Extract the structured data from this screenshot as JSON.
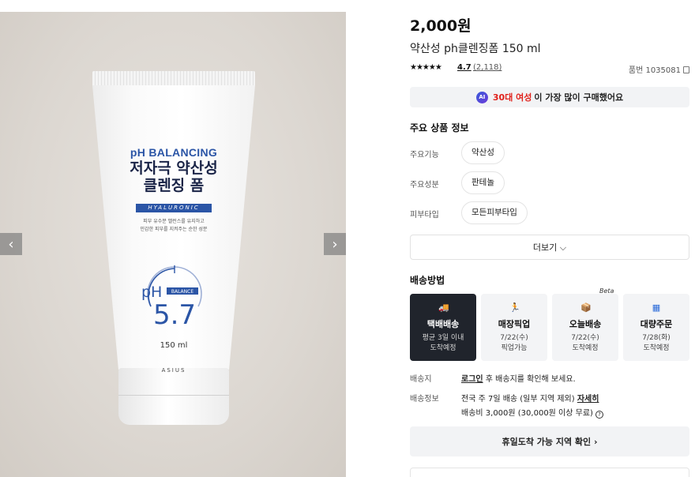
{
  "gallery": {
    "prev_icon": "chevron-left-icon",
    "next_icon": "chevron-right-icon",
    "product_image": {
      "brand_line": "pH BALANCING",
      "title_line1": "저자극 약산성",
      "title_line2": "클렌징 폼",
      "badge": "HYALURONIC",
      "desc_line1": "피부 유수분 밸런스를 유지하고",
      "desc_line2": "민감한 피부를 지켜주는 순한 성분",
      "ph_prefix": "pH",
      "ph_badge": "BALANCE",
      "ph_value": "5.7",
      "volume": "150 ml",
      "logo": "ASIUS"
    }
  },
  "product": {
    "price": "2,000원",
    "name": "약산성 ph클렌징폼 150 ml",
    "stars": "★★★★★",
    "rating": "4.7",
    "review_count": "(2,118)",
    "product_number": "품번 1035081"
  },
  "ai_banner": {
    "badge": "AI",
    "highlight": "30대 여성",
    "rest": "이 가장 많이 구매했어요"
  },
  "specs": {
    "title": "주요 상품 정보",
    "rows": [
      {
        "label": "주요기능",
        "value": "약산성"
      },
      {
        "label": "주요성분",
        "value": "판테놀"
      },
      {
        "label": "피부타입",
        "value": "모든피부타입"
      }
    ],
    "more_label": "더보기 ⌵"
  },
  "shipping": {
    "title": "배송방법",
    "beta": "Beta",
    "options": [
      {
        "name": "택배배송",
        "sub1": "평균 3일 이내",
        "sub2": "도착예정",
        "icon": "truck-icon",
        "active": true
      },
      {
        "name": "매장픽업",
        "sub1": "7/22(수)",
        "sub2": "픽업가능",
        "icon": "store-pickup-icon",
        "active": false
      },
      {
        "name": "오늘배송",
        "sub1": "7/22(수)",
        "sub2": "도착예정",
        "icon": "today-delivery-icon",
        "active": false
      },
      {
        "name": "대량주문",
        "sub1": "7/28(화)",
        "sub2": "도착예정",
        "icon": "bulk-order-icon",
        "active": false
      }
    ],
    "destination_label": "배송지",
    "destination_login": "로그인",
    "destination_text": " 후 배송지를 확인해 보세요.",
    "info_label": "배송정보",
    "info_line1": "전국 주 7일 배송 (일부 지역 제외) ",
    "info_detail": "자세히",
    "info_line2": "배송비 3,000원 (30,000원 이상 무료)",
    "holiday_button": "휴일도착 가능 지역 확인  ›"
  },
  "colors": {
    "accent_red": "#e0201a",
    "brand_blue": "#2b55a6",
    "active_card": "#20242c"
  }
}
